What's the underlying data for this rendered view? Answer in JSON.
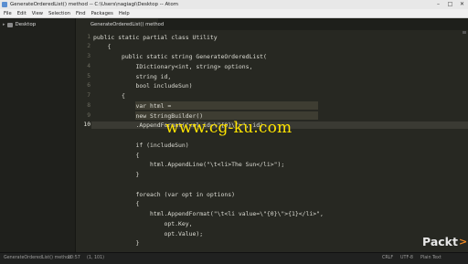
{
  "window": {
    "title": "GenerateOrderedList() method -- C:\\Users\\nagiagi\\Desktop -- Atom"
  },
  "menu": [
    "File",
    "Edit",
    "View",
    "Selection",
    "Find",
    "Packages",
    "Help"
  ],
  "sidebar": {
    "items": [
      {
        "label": "Desktop"
      }
    ]
  },
  "tabs": [
    {
      "label": "GenerateOrderedList() method"
    }
  ],
  "editor": {
    "active_line": 10,
    "lines": [
      {
        "num": "1",
        "text": "public static partial class Utility"
      },
      {
        "num": "2",
        "text": "    {"
      },
      {
        "num": "3",
        "text": "        public static string GenerateOrderedList("
      },
      {
        "num": "4",
        "text": "            IDictionary<int, string> options,"
      },
      {
        "num": "5",
        "text": "            string id,"
      },
      {
        "num": "6",
        "text": "            bool includeSun)"
      },
      {
        "num": "7",
        "text": "        {"
      },
      {
        "num": "8",
        "text": "            var html ="
      },
      {
        "num": "9",
        "text": "            new StringBuilder()"
      },
      {
        "num": "10",
        "text": "            .AppendFormat(\"<ol id=\\\"{0}\\\">\", id)"
      },
      {
        "num": "",
        "text": ""
      },
      {
        "num": "",
        "text": "            if (includeSun)"
      },
      {
        "num": "",
        "text": "            {"
      },
      {
        "num": "",
        "text": "                html.AppendLine(\"\\t<li>The Sun</li>\");"
      },
      {
        "num": "",
        "text": "            }"
      },
      {
        "num": "",
        "text": ""
      },
      {
        "num": "",
        "text": "            foreach (var opt in options)"
      },
      {
        "num": "",
        "text": "            {"
      },
      {
        "num": "",
        "text": "                html.AppendFormat(\"\\t<li value=\\\"{0}\\\">{1}</li>\","
      },
      {
        "num": "",
        "text": "                    opt.Key,"
      },
      {
        "num": "",
        "text": "                    opt.Value);"
      },
      {
        "num": "",
        "text": "            }"
      }
    ]
  },
  "watermark": "www.cg-ku.com",
  "status": {
    "file": "GenerateOrderedList() method",
    "cursor": "10:57",
    "selection": "(1, 101)",
    "line_ending": "CRLF",
    "encoding": "UTF-8",
    "grammar": "Plain Text"
  },
  "brand": {
    "text": "Packt",
    "mark": ">"
  },
  "colors": {
    "editor_bg": "#272822",
    "watermark": "#ffe400",
    "packt_accent": "#f08a24",
    "selection": "#3e3d32"
  }
}
